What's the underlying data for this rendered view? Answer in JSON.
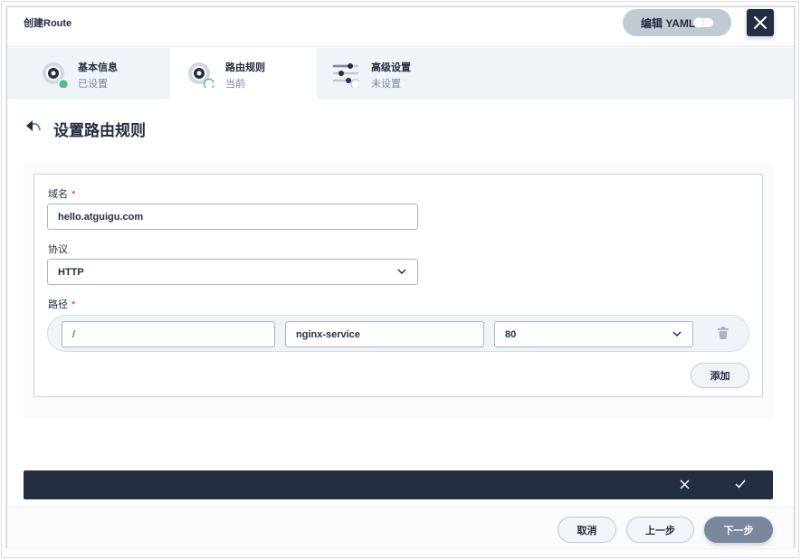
{
  "header": {
    "title": "创建Route",
    "yaml_label": "编辑 YAML",
    "close_icon": "close-icon"
  },
  "steps": [
    {
      "title": "基本信息",
      "status": "已设置"
    },
    {
      "title": "路由规则",
      "status": "当前"
    },
    {
      "title": "高级设置",
      "status": "未设置"
    }
  ],
  "section": {
    "title": "设置路由规则"
  },
  "form": {
    "domain_label": "域名",
    "domain_required": "*",
    "domain_value": "hello.atguigu.com",
    "protocol_label": "协议",
    "protocol_value": "HTTP",
    "path_label": "路径",
    "path_required": "*",
    "path_value": "/",
    "service_value": "nginx-service",
    "port_value": "80",
    "add_label": "添加"
  },
  "footer": {
    "cancel": "取消",
    "prev": "上一步",
    "next": "下一步"
  },
  "colors": {
    "accent": "#55bc8a",
    "dark": "#242e42",
    "muted": "#79879c"
  }
}
